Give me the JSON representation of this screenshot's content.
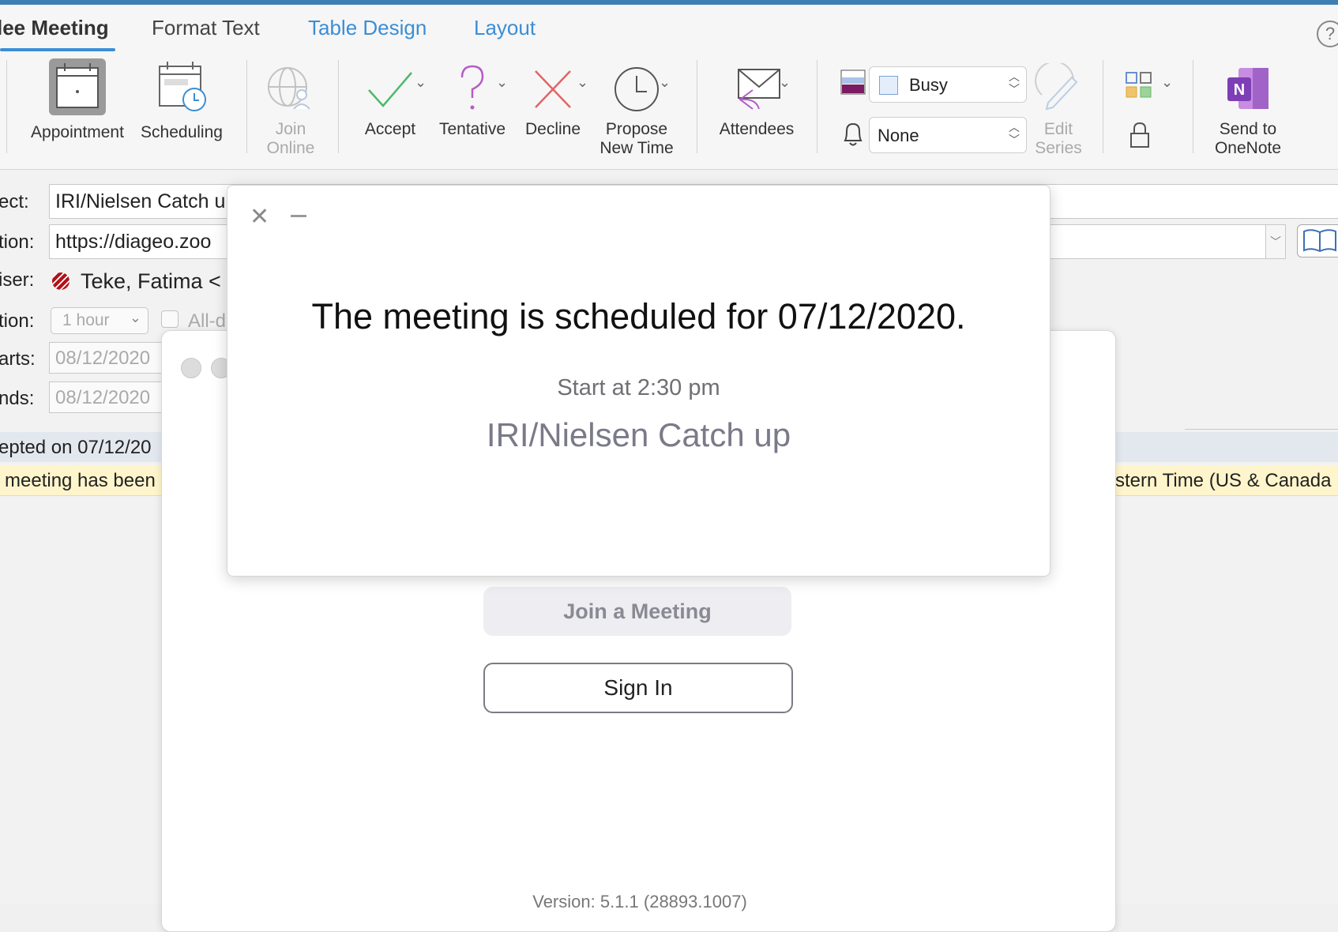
{
  "tabs": [
    {
      "label": "lee Meeting"
    },
    {
      "label": "Format Text"
    },
    {
      "label": "Table Design"
    },
    {
      "label": "Layout"
    }
  ],
  "ribbon": {
    "appointment": "Appointment",
    "scheduling": "Scheduling",
    "join_online_1": "Join",
    "join_online_2": "Online",
    "accept": "Accept",
    "tentative": "Tentative",
    "decline": "Decline",
    "propose_1": "Propose",
    "propose_2": "New Time",
    "attendees": "Attendees",
    "show_as": "Busy",
    "reminder": "None",
    "edit_series_1": "Edit",
    "edit_series_2": "Series",
    "onenote_1": "Send to",
    "onenote_2": "OneNote"
  },
  "form": {
    "subject_label": "ect:",
    "subject_value": "IRI/Nielsen Catch u",
    "location_label": "tion:",
    "location_value": "https://diageo.zoo",
    "organiser_label": "iser:",
    "organiser_value": "Teke, Fatima <",
    "duration_label": "tion:",
    "duration_value": "1 hour",
    "allday_label": "All-d",
    "starts_label": "arts:",
    "starts_value": "08/12/2020",
    "ends_label": "nds:",
    "ends_value": "08/12/2020",
    "accepted_text": "epted on 07/12/20",
    "info_left": "meeting has been",
    "info_right": "stern Time (US & Canada"
  },
  "zoom": {
    "join_label": "Join a Meeting",
    "signin_label": "Sign In",
    "version": "Version: 5.1.1 (28893.1007)"
  },
  "notice": {
    "title": "The meeting is scheduled for 07/12/2020.",
    "start": "Start at 2:30 pm",
    "meeting_name": "IRI/Nielsen Catch up"
  },
  "colors": {
    "accent": "#3a8ed6",
    "accept": "#4cb86a",
    "tentative": "#b45cc8",
    "decline": "#e26565",
    "onenote": "#7e3fb6",
    "infobar": "#fff5cc",
    "accepted_bar": "#e3e8ef"
  }
}
